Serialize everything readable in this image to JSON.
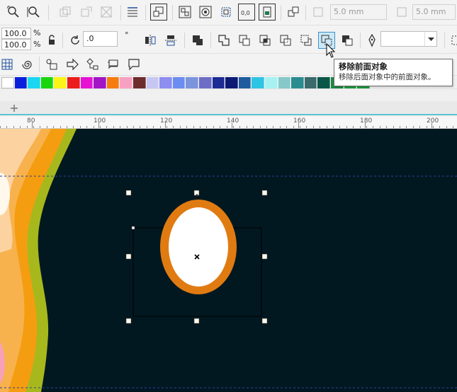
{
  "toolbar_top": {
    "outline_width_1": "5.0 mm",
    "outline_width_2": "5.0 mm",
    "icons": [
      "zoom-icon",
      "zoom-select-icon",
      "weld-disabled-icon",
      "trim-disabled-icon",
      "intersect-disabled-icon",
      "text-align-icon",
      "group-icon",
      "ungroup-icon",
      "unlock-icon",
      "combine-icon",
      "break-apart-icon",
      "order-icon",
      "outline-width-icon"
    ]
  },
  "property_bar": {
    "scale_x": "100.0",
    "scale_y": "100.0",
    "percent_x": "%",
    "percent_y": "%",
    "rotation": ".0",
    "degree": "°"
  },
  "toolbox_row": {
    "icons": [
      "grid-icon",
      "spiral-icon",
      "arrow-shape-icon",
      "flowchart-icon",
      "banner-icon",
      "callout-icon"
    ]
  },
  "palette": {
    "colors": [
      "#ffffff",
      "#0a1fdc",
      "#1bd6f0",
      "#18d60e",
      "#fbf418",
      "#ea1d1c",
      "#e611d3",
      "#a115c7",
      "#f77c10",
      "#f7a1c2",
      "#6e2d2d",
      "#c7c7f3",
      "#8d8ef0",
      "#6b8cf0",
      "#7b95dc",
      "#6d6dc8",
      "#1e2b94",
      "#0c1a74",
      "#1f5c9d",
      "#2ec4e3",
      "#a6f2f2",
      "#87c8c8",
      "#2a8c8f",
      "#3b6a6d",
      "#0a5748",
      "#198a43",
      "#1a9e3e",
      "#1c9a3f"
    ]
  },
  "ruler": {
    "labels": [
      "80",
      "100",
      "120",
      "140",
      "160",
      "180",
      "200"
    ]
  },
  "tooltip": {
    "title": "移除前面对象",
    "desc": "移除后面对象中的前面对象。"
  },
  "canvas": {
    "background": "#021821",
    "ring_color": "#e07b12"
  }
}
